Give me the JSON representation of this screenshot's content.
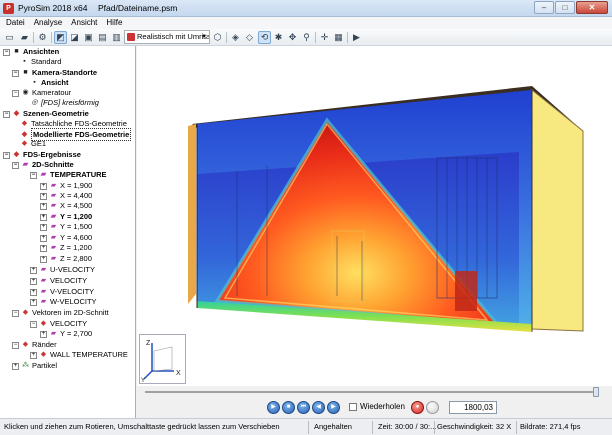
{
  "window": {
    "app_title": "PyroSim 2018 x64",
    "file_title": "Pfad/Dateiname.psm",
    "app_icon_text": "P"
  },
  "menu": [
    "Datei",
    "Analyse",
    "Ansicht",
    "Hilfe"
  ],
  "toolbar": {
    "view_select": "Realistisch mit Umriss"
  },
  "tree": {
    "ansichten": "Ansichten",
    "standard": "Standard",
    "kamera_standorte": "Kamera-Standorte",
    "ansicht": "Ansicht",
    "kameratour": "Kameratour",
    "fds_kreis": "[FDS] kreisförmig",
    "szenen_geometrie": "Szenen-Geometrie",
    "tatsaechliche": "Tatsächliche FDS-Geometrie",
    "modellierte": "Modellierte FDS-Geometrie",
    "ge1": "GE1",
    "fds_ergebnisse": "FDS-Ergebnisse",
    "schnitte_2d": "2D-Schnitte",
    "temperature": "TEMPERATURE",
    "slices": [
      "X = 1,900",
      "X = 4,400",
      "X = 4,500",
      "Y = 1,200",
      "Y = 1,500",
      "Y = 4,600",
      "Z = 1,200",
      "Z = 2,800"
    ],
    "u_velocity": "U-VELOCITY",
    "velocity": "VELOCITY",
    "v_velocity": "V-VELOCITY",
    "w_velocity": "W-VELOCITY",
    "vektoren": "Vektoren im 2D-Schnitt",
    "vek_velocity": "VELOCITY",
    "vek_y": "Y = 2,700",
    "raender": "Ränder",
    "wall_temp": "WALL TEMPERATURE",
    "partikel": "Partikel"
  },
  "viewport": {
    "axis_z": "Z",
    "axis_x": "X",
    "axis_y": "Y"
  },
  "playback": {
    "repeat_label": "Wiederholen",
    "time_value": "1800,03"
  },
  "status": {
    "hint": "Klicken und ziehen zum Rotieren, Umschalttaste gedrückt lassen zum Verschieben",
    "state": "Angehalten",
    "time": "Zeit: 30:00 / 30:...",
    "speed": "Geschwindigkeit: 32 X",
    "rate": "Bildrate: 271,4 fps"
  }
}
